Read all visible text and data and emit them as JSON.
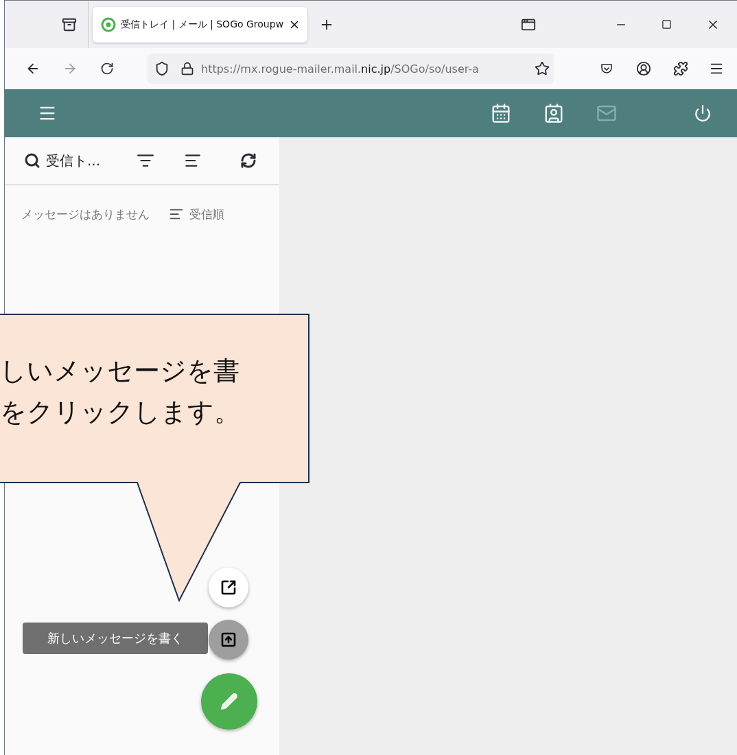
{
  "browser": {
    "tab": {
      "title": "受信トレイ | メール | SOGo Groupw",
      "selected": true
    },
    "url": "https://mx.rogue-mailer.mail.**nic.jp**/SOGo/so/user-a"
  },
  "app_bar": {
    "apps": [
      {
        "kind": "calendar",
        "selected": false
      },
      {
        "kind": "contacts",
        "selected": false
      },
      {
        "kind": "mail",
        "selected": true
      }
    ]
  },
  "mail_list": {
    "folder": "受信ト...",
    "empty_text": "メッセージはありません",
    "sort_label": "受信順"
  },
  "fab": {
    "tooltip": "新しいメッセージを書く"
  },
  "callout": {
    "lines": [
      "しいメッセージを書",
      "をクリックします。"
    ]
  }
}
